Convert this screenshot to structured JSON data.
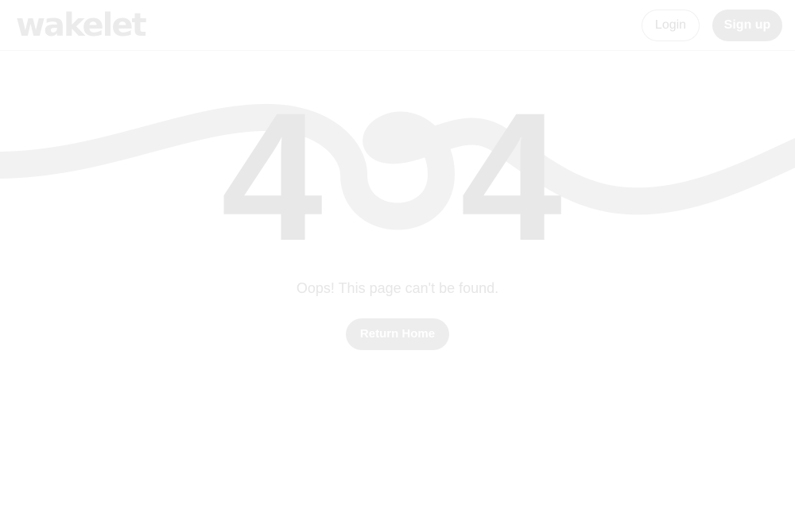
{
  "header": {
    "logo_text": "wakelet",
    "login_label": "Login",
    "signup_label": "Sign up"
  },
  "error": {
    "code_left": "4",
    "code_right": "4",
    "message": "Oops! This page can't be found.",
    "return_home_label": "Return Home"
  },
  "colors": {
    "digit": "#e8e8e8",
    "ribbon": "#f2f2f2",
    "text_faint": "#e6e6e6"
  }
}
